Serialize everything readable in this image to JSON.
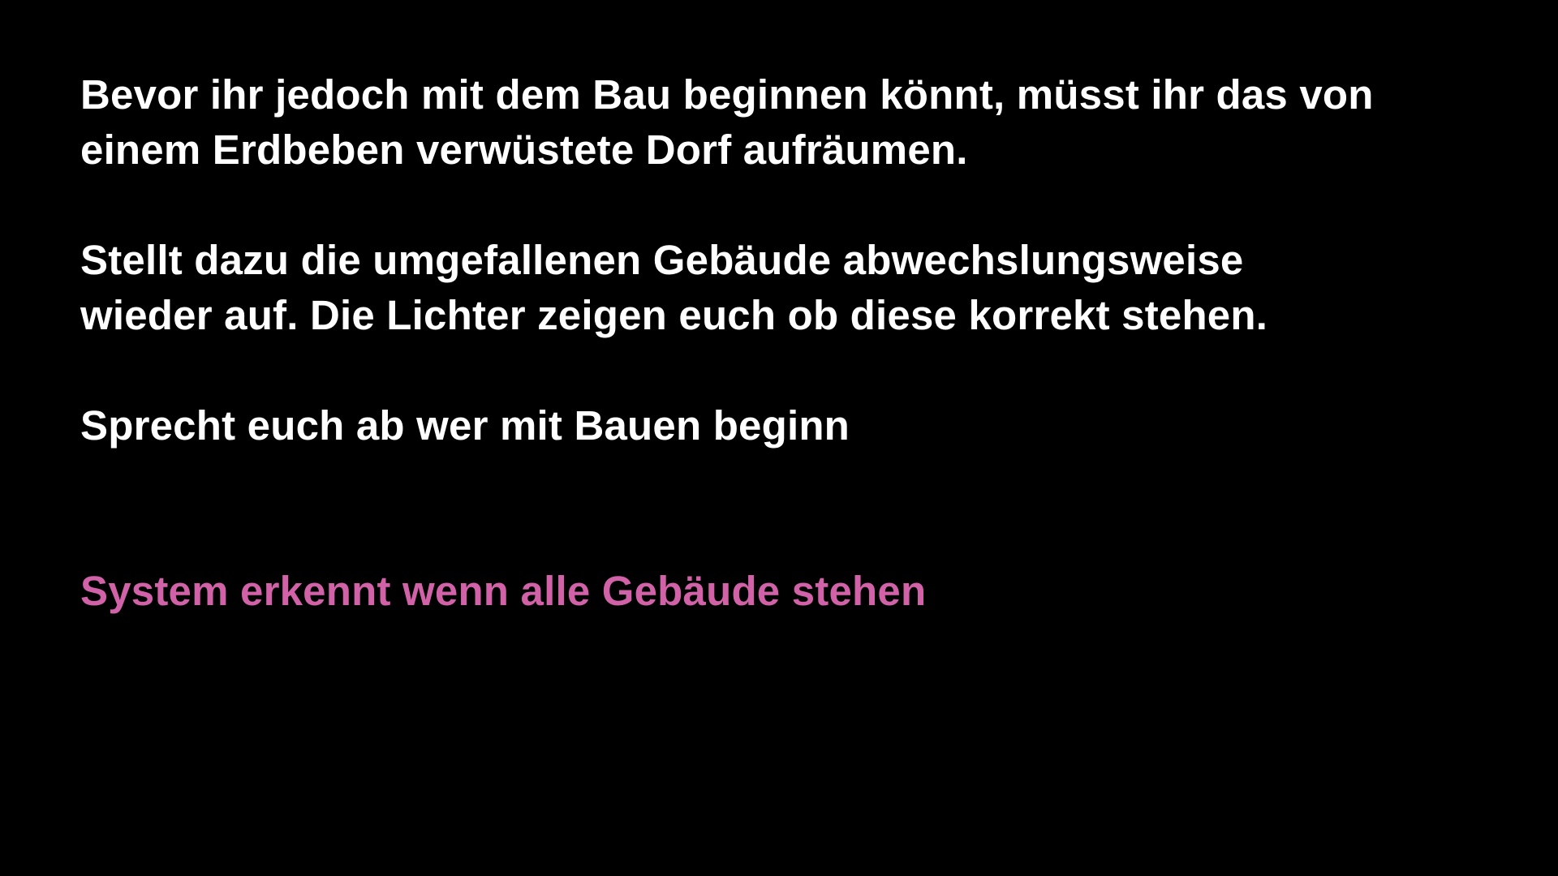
{
  "slide": {
    "paragraphs": [
      {
        "lines": [
          "Bevor ihr jedoch mit dem Bau beginnen könnt, müsst ihr das von",
          "einem Erdbeben verwüstete Dorf aufräumen."
        ]
      },
      {
        "lines": [
          "Stellt dazu die umgefallenen Gebäude abwechslungsweise",
          "wieder auf. Die Lichter zeigen euch ob diese korrekt stehen."
        ]
      },
      {
        "lines": [
          "Sprecht euch ab wer mit Bauen beginn"
        ]
      }
    ],
    "note": "System erkennt wenn alle Gebäude stehen"
  },
  "colors": {
    "background": "#000000",
    "text": "#ffffff",
    "note": "#d162a8"
  }
}
